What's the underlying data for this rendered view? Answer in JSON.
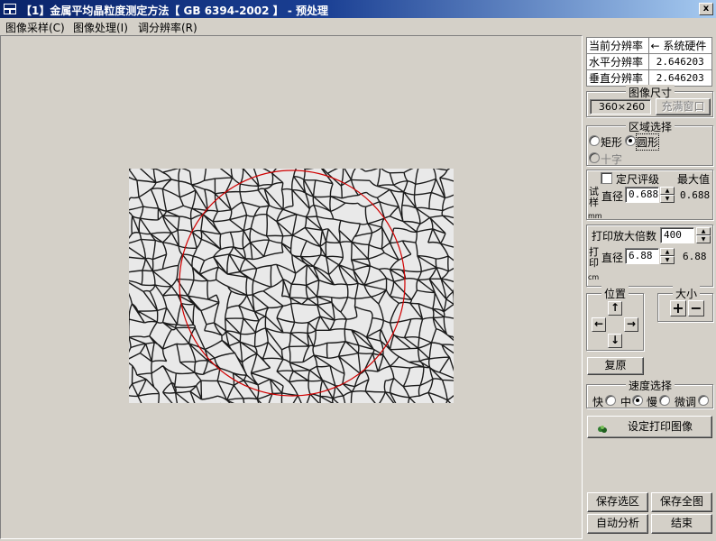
{
  "window": {
    "title": "【1】金属平均晶粒度测定方法【 GB 6394-2002 】 - 预处理",
    "close_glyph": "x"
  },
  "menu": [
    {
      "label": "图像采样(C)"
    },
    {
      "label": "图像处理(I)"
    },
    {
      "label": "调分辨率(R)"
    }
  ],
  "resolution_table": {
    "header": [
      "当前分辨率",
      "← 系统硬件"
    ],
    "rows": [
      {
        "label": "水平分辨率",
        "value": "2.646203"
      },
      {
        "label": "垂直分辨率",
        "value": "2.646203"
      }
    ]
  },
  "image_size": {
    "legend": "图像尺寸",
    "value": "360×260",
    "fill_button": "充满窗口"
  },
  "region": {
    "legend": "区域选择",
    "rect": "矩形",
    "circle": "圆形",
    "cross": "十字",
    "selected": "circle"
  },
  "ruler": {
    "checkbox_label": "定尺评级",
    "max_label": "最大值",
    "side_label": "试样",
    "unit": "mm",
    "diameter_label": "直径",
    "value": "0.688",
    "max_value": "0.688"
  },
  "print": {
    "magnification_label": "打印放大倍数",
    "magnification": "400",
    "side_label": "打印",
    "unit": "cm",
    "diameter_label": "直径",
    "value": "6.88",
    "max_value": "6.88"
  },
  "position": {
    "legend": "位置",
    "up": "↑",
    "down": "↓",
    "left": "←",
    "right": "→"
  },
  "size": {
    "legend": "大小",
    "plus": "+",
    "minus": "−"
  },
  "reset_button": "复原",
  "speed": {
    "legend": "速度选择",
    "fast": "快",
    "mid": "中",
    "slow": "慢",
    "fine": "微调",
    "selected": "mid"
  },
  "set_print_button": "设定打印图像",
  "save_selection_button": "保存选区",
  "save_all_button": "保存全图",
  "auto_analyze_button": "自动分析",
  "end_button": "结束",
  "colors": {
    "title_bar": "#0a246a",
    "circle_overlay": "#d00000",
    "background": "#d4d0c8"
  }
}
